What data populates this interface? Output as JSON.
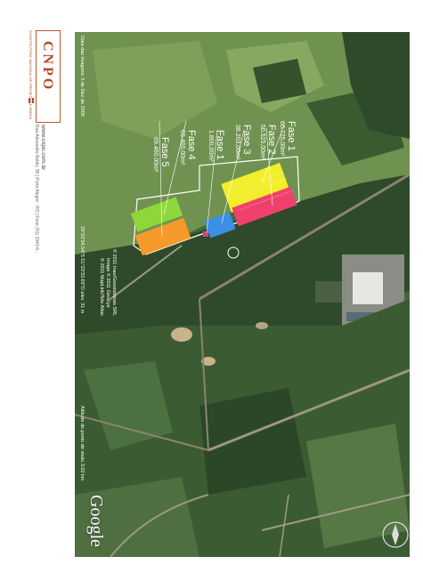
{
  "brand": {
    "logo": "CNPO",
    "tagline": "CONSTRUTORA NACIONAL DE PROJETOS E OBRAS",
    "website": "www.cnpo.com.br",
    "address": "Rua Alexandre Boldo, 35 | Porto Alegre - RS | Fone (51) 3343-6..."
  },
  "map": {
    "imagery_date": "Data das imagens: 5 de Dez de 2009",
    "coordinates": "29°53'34.54\"S 51°23'33.69\"O  elev. 31 m",
    "copyright_1": "© 2011 Inav/Geosistemas SRL",
    "copyright_2": "Image © 2011 GeoEye",
    "copyright_3": "© 2011 MapLink/Tele Atlas",
    "eye_altitude": "Altitude do ponto de visão    3.02 km",
    "google": "Google"
  },
  "phases": [
    {
      "name": "Fase 1",
      "area": "60.725,00m²",
      "color": "#f2ee2a"
    },
    {
      "name": "Fase 2",
      "area": "50.525,00m²",
      "color": "#f0406c"
    },
    {
      "name": "Fase 3",
      "area": "38.203,00m²",
      "color": "#3a8fe6"
    },
    {
      "name": "Fase 1",
      "area": "1.800,00m²",
      "color": "#d8407a"
    },
    {
      "name": "Fase 4",
      "area": "69.460,00m²",
      "color": "#8ed63a"
    },
    {
      "name": "Fase 5",
      "area": "69.460,00m²",
      "color": "#f59a2a"
    }
  ],
  "colors": {
    "forest_dark": "#2f4a2a",
    "forest_mid": "#3f6233",
    "field_light": "#7fa05a",
    "site_outline": "#ffffff",
    "brand_accent": "#b24a24"
  }
}
